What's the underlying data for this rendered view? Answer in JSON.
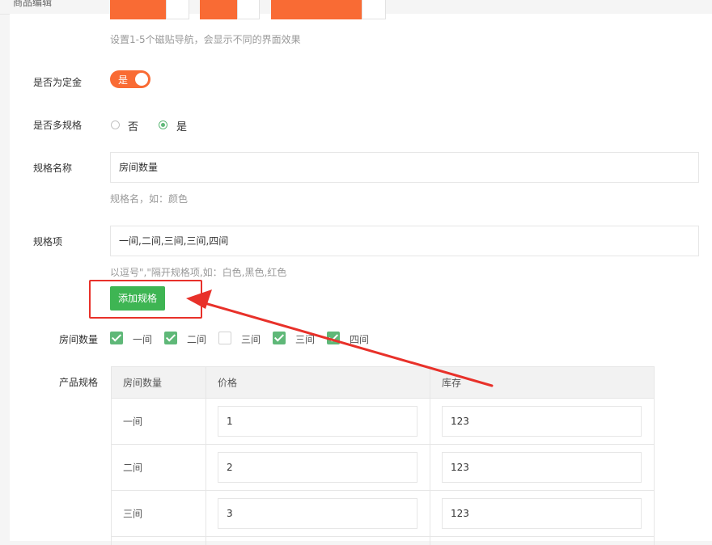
{
  "header": {
    "crumb": "商品编辑"
  },
  "tiles": {
    "hint": "设置1-5个磁贴导航，会显示不同的界面效果"
  },
  "deposit": {
    "label": "是否为定金",
    "toggle_text": "是",
    "enabled": true
  },
  "multispec": {
    "label": "是否多规格",
    "options": [
      {
        "text": "否",
        "selected": false
      },
      {
        "text": "是",
        "selected": true
      }
    ]
  },
  "spec_name": {
    "label": "规格名称",
    "value": "房间数量",
    "hint": "规格名，如：颜色"
  },
  "spec_items": {
    "label": "规格项",
    "value": "一间,二间,三间,三间,四间",
    "hint": "以逗号\",\"隔开规格项,如：白色,黑色,红色"
  },
  "add_button": {
    "label": "添加规格"
  },
  "spec_check": {
    "label": "房间数量",
    "options": [
      {
        "text": "一间",
        "checked": true
      },
      {
        "text": "二间",
        "checked": true
      },
      {
        "text": "三间",
        "checked": false
      },
      {
        "text": "三间",
        "checked": true
      },
      {
        "text": "四间",
        "checked": true
      }
    ]
  },
  "product_spec": {
    "label": "产品规格",
    "columns": [
      "房间数量",
      "价格",
      "库存"
    ],
    "rows": [
      {
        "name": "一间",
        "price": "1",
        "stock": "123"
      },
      {
        "name": "二间",
        "price": "2",
        "stock": "123"
      },
      {
        "name": "三间",
        "price": "3",
        "stock": "123"
      }
    ]
  },
  "colors": {
    "accent": "#f96b34",
    "green": "#3eb553",
    "check_green": "#5fb878",
    "annotation_red": "#e8312a"
  }
}
